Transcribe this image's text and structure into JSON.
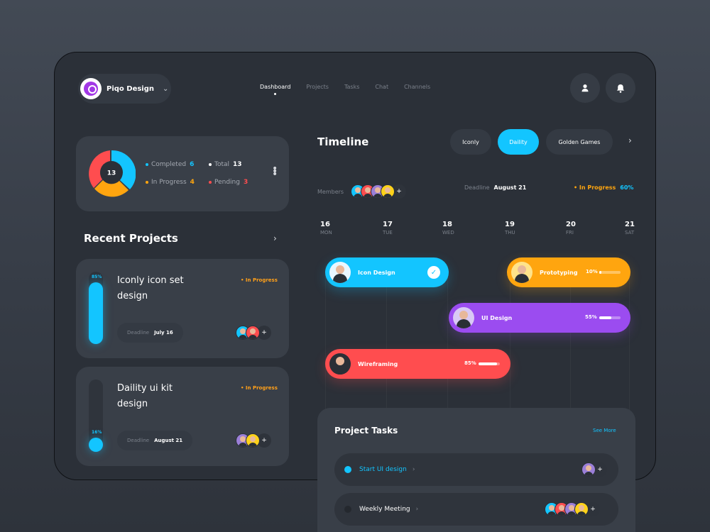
{
  "brand": {
    "name": "Piqo Design"
  },
  "nav": {
    "items": [
      {
        "label": "Dashboard",
        "active": true
      },
      {
        "label": "Projects",
        "active": false
      },
      {
        "label": "Tasks",
        "active": false
      },
      {
        "label": "Chat",
        "active": false
      },
      {
        "label": "Channels",
        "active": false
      }
    ]
  },
  "stats": {
    "total_center": "13",
    "completed_label": "Completed",
    "completed_value": "6",
    "total_label": "Total",
    "total_value": "13",
    "inprogress_label": "In Progress",
    "inprogress_value": "4",
    "pending_label": "Pending",
    "pending_value": "3"
  },
  "recent": {
    "title": "Recent Projects",
    "projects": [
      {
        "title": "Iconly icon set design",
        "status": "In Progress",
        "progress": "85%",
        "progress_value": 85,
        "deadline_label": "Deadline",
        "deadline": "July 16"
      },
      {
        "title": "Daility ui kit design",
        "status": "In Progress",
        "progress": "16%",
        "progress_value": 16,
        "deadline_label": "Deadline",
        "deadline": "August 21"
      }
    ]
  },
  "timeline": {
    "title": "Timeline",
    "tabs": [
      {
        "label": "Iconly",
        "active": false
      },
      {
        "label": "Daility",
        "active": true
      },
      {
        "label": "Golden Games",
        "active": false
      }
    ],
    "members_label": "Members",
    "deadline_label": "Deadline",
    "deadline_value": "August 21",
    "status_label": "In Progress",
    "status_value": "60%",
    "days": [
      {
        "d": "16",
        "w": "MON"
      },
      {
        "d": "17",
        "w": "TUE"
      },
      {
        "d": "18",
        "w": "WED"
      },
      {
        "d": "19",
        "w": "THU"
      },
      {
        "d": "20",
        "w": "FRI"
      },
      {
        "d": "21",
        "w": "SAT"
      }
    ],
    "tasks": [
      {
        "name": "Icon Design",
        "pct": "",
        "progress_value": 100,
        "color": "#13c5ff"
      },
      {
        "name": "Prototyping",
        "pct": "10%",
        "progress_value": 10,
        "color": "#ffa50f"
      },
      {
        "name": "UI Design",
        "pct": "55%",
        "progress_value": 55,
        "color": "#9b4cf0"
      },
      {
        "name": "Wireframing",
        "pct": "85%",
        "progress_value": 85,
        "color": "#ff4d4f"
      }
    ]
  },
  "project_tasks": {
    "title": "Project Tasks",
    "see_more": "See More",
    "rows": [
      {
        "label": "Start UI design",
        "color": "#13c5ff"
      },
      {
        "label": "Weekly Meeting",
        "color": "#2a2e35"
      }
    ]
  },
  "colors": {
    "accent": "#13c5ff",
    "orange": "#ffa50f",
    "purple": "#9b4cf0",
    "red": "#ff4d4f"
  }
}
